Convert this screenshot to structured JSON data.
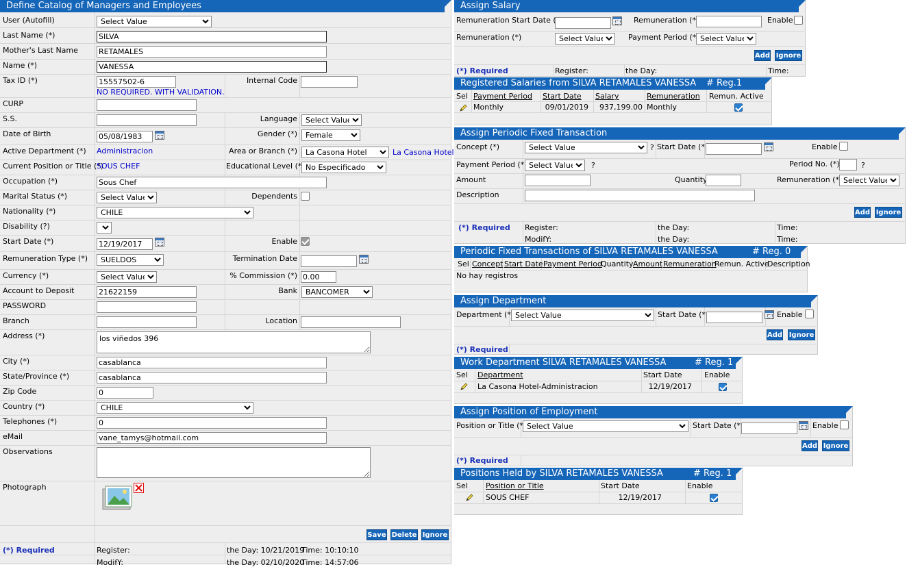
{
  "left": {
    "title": "Define Catalog of Managers and Employees",
    "labels": {
      "user": "User (Autofill)",
      "last_name": "Last Name (*)",
      "mothers_last_name": "Mother's Last Name",
      "name": "Name (*)",
      "tax_id": "Tax ID (*)",
      "internal_code": "Internal Code",
      "curp": "CURP",
      "ss": "S.S.",
      "language": "Language",
      "dob": "Date of Birth",
      "gender": "Gender (*)",
      "active_dept": "Active Department (*)",
      "area": "Area or Branch (*)",
      "position": "Current Position or Title (*)",
      "edu": "Educational Level (*)",
      "occupation": "Occupation (*)",
      "marital": "Marital Status (*)",
      "dependents": "Dependents",
      "nationality": "Nationality (*)",
      "disability": "Disability (?)",
      "start_date": "Start Date (*)",
      "enable": "Enable",
      "rem_type": "Remuneration Type (*)",
      "termination": "Termination Date",
      "currency": "Currency (*)",
      "commission": "% Commission (*)",
      "account": "Account to Deposit",
      "bank": "Bank",
      "password": "PASSWORD",
      "branch": "Branch",
      "location": "Location",
      "address": "Address (*)",
      "city": "City (*)",
      "state": "State/Province (*)",
      "zip": "Zip Code",
      "country": "Country (*)",
      "telephones": "Telephones (*)",
      "email": "eMail",
      "observations": "Observations",
      "photograph": "Photograph"
    },
    "values": {
      "user": "Select Value",
      "last_name": "SILVA",
      "mothers_last_name": "RETAMALES",
      "name": "VANESSA",
      "tax_id": "15557502-6",
      "tax_note": "NO REQUIRED. WITH VALIDATION.",
      "language": "Select Value",
      "dob": "05/08/1983",
      "gender": "Female",
      "active_dept": "Administracion",
      "area": "La Casona Hotel",
      "area_link": "La Casona Hotel",
      "position": "SOUS CHEF",
      "edu": "No Especificado",
      "occupation": "Sous Chef",
      "marital": "Select Value",
      "nationality": "CHILE",
      "start_date": "12/19/2017",
      "rem_type": "SUELDOS",
      "currency": "Select Value",
      "commission": "0.00",
      "account": "21622159",
      "bank": "BANCOMER",
      "address": "los viñedos 396",
      "city": "casablanca",
      "state": "casablanca",
      "zip": "0",
      "country": "CHILE",
      "telephones": "0",
      "email": "vane_tamys@hotmail.com"
    },
    "buttons": {
      "save": "Save",
      "delete": "Delete",
      "ignore": "Ignore"
    },
    "footer": {
      "required": "(*) Required",
      "register": "Register:",
      "modify": "ModifY:",
      "day1": "the Day: 10/21/2019",
      "time1": "Time: 10:10:10",
      "day2": "the Day: 02/10/2020",
      "time2": "Time: 14:57:06"
    }
  },
  "salary": {
    "title": "Assign Salary",
    "rem_start": "Remuneration Start Date (*)",
    "remuneration": "Remuneration (*)",
    "enable": "Enable",
    "rem_select_label": "Remuneration (*)",
    "rem_select": "Select Value",
    "pay_period": "Payment Period (*)",
    "pay_select": "Select Value",
    "add": "Add",
    "ignore": "Ignore",
    "required": "(*) Required",
    "register": "Register:",
    "day": "the Day:",
    "time": "Time:"
  },
  "reg_salaries": {
    "title": "Registered Salaries from SILVA RETAMALES VANESSA",
    "reg": "# Reg.1",
    "headers": [
      "Sel",
      "Payment Period",
      "Start Date",
      "Salary",
      "Remuneration",
      "Remun. Active"
    ],
    "row": {
      "period": "Monthly",
      "start": "09/01/2019",
      "salary": "937,199.00",
      "remuneration": "Monthly"
    }
  },
  "periodic": {
    "title": "Assign Periodic Fixed Transaction",
    "concept": "Concept (*)",
    "concept_val": "Select Value",
    "start": "Start Date (*)",
    "enable": "Enable",
    "pay_period": "Payment Period (*)",
    "pay_val": "Select Value",
    "period_no": "Period No. (*)",
    "amount": "Amount",
    "quantity": "Quantity",
    "remuneration": "Remuneration (*)",
    "rem_val": "Select Value",
    "description": "Description",
    "q": "?",
    "add": "Add",
    "ignore": "Ignore",
    "required": "(*) Required",
    "register": "Register:",
    "modify": "ModifY:",
    "day": "the Day:",
    "time": "Time:"
  },
  "periodic_list": {
    "title": "Periodic Fixed Transactions of SILVA RETAMALES VANESSA",
    "reg": "# Reg. 0",
    "headers": [
      "Sel",
      "Concept",
      "Start Date",
      "Payment Period",
      "Quantity",
      "Amount",
      "Remuneration",
      "Remun. Active",
      "Description"
    ],
    "empty": "No hay registros"
  },
  "dept": {
    "title": "Assign Department",
    "department": "Department (*)",
    "dept_val": "Select Value",
    "start": "Start Date (*)",
    "enable": "Enable",
    "add": "Add",
    "ignore": "Ignore",
    "required": "(*) Required"
  },
  "work_dept": {
    "title": "Work Department SILVA RETAMALES VANESSA",
    "reg": "# Reg. 1",
    "headers": [
      "Sel",
      "Department",
      "Start Date",
      "Enable"
    ],
    "row": {
      "department": "La Casona Hotel-Administracion",
      "start": "12/19/2017"
    }
  },
  "position": {
    "title": "Assign Position of Employment",
    "position": "Position or Title (*)",
    "pos_val": "Select Value",
    "start": "Start Date (*)",
    "enable": "Enable",
    "add": "Add",
    "ignore": "Ignore",
    "required": "(*) Required"
  },
  "positions_held": {
    "title": "Positions Held by SILVA RETAMALES VANESSA",
    "reg": "# Reg. 1",
    "headers": [
      "Sel",
      "Position or Title",
      "Start Date",
      "Enable"
    ],
    "row": {
      "position": "SOUS CHEF",
      "start": "12/19/2017"
    }
  }
}
